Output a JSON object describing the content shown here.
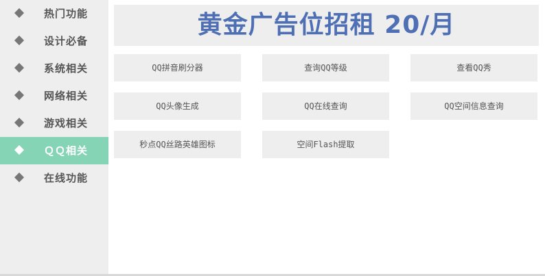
{
  "sidebar": {
    "items": [
      {
        "label": "热门功能",
        "active": false
      },
      {
        "label": "设计必备",
        "active": false
      },
      {
        "label": "系统相关",
        "active": false
      },
      {
        "label": "网络相关",
        "active": false
      },
      {
        "label": "游戏相关",
        "active": false
      },
      {
        "label": "ＱＱ相关",
        "active": true
      },
      {
        "label": "在线功能",
        "active": false
      }
    ]
  },
  "banner": {
    "text": "黄金广告位招租 20/月"
  },
  "tools": [
    {
      "label": "QQ拼音刷分器"
    },
    {
      "label": "查询QQ等级"
    },
    {
      "label": "查看QQ秀"
    },
    {
      "label": "QQ头像生成"
    },
    {
      "label": "QQ在线查询"
    },
    {
      "label": "QQ空间信息查询"
    },
    {
      "label": "秒点QQ丝路英雄图标"
    },
    {
      "label": "空间Flash提取"
    }
  ],
  "colors": {
    "accent": "#85d4b6",
    "banner_text": "#4f6fb4",
    "panel_bg": "#eeeeee",
    "text": "#555555"
  }
}
